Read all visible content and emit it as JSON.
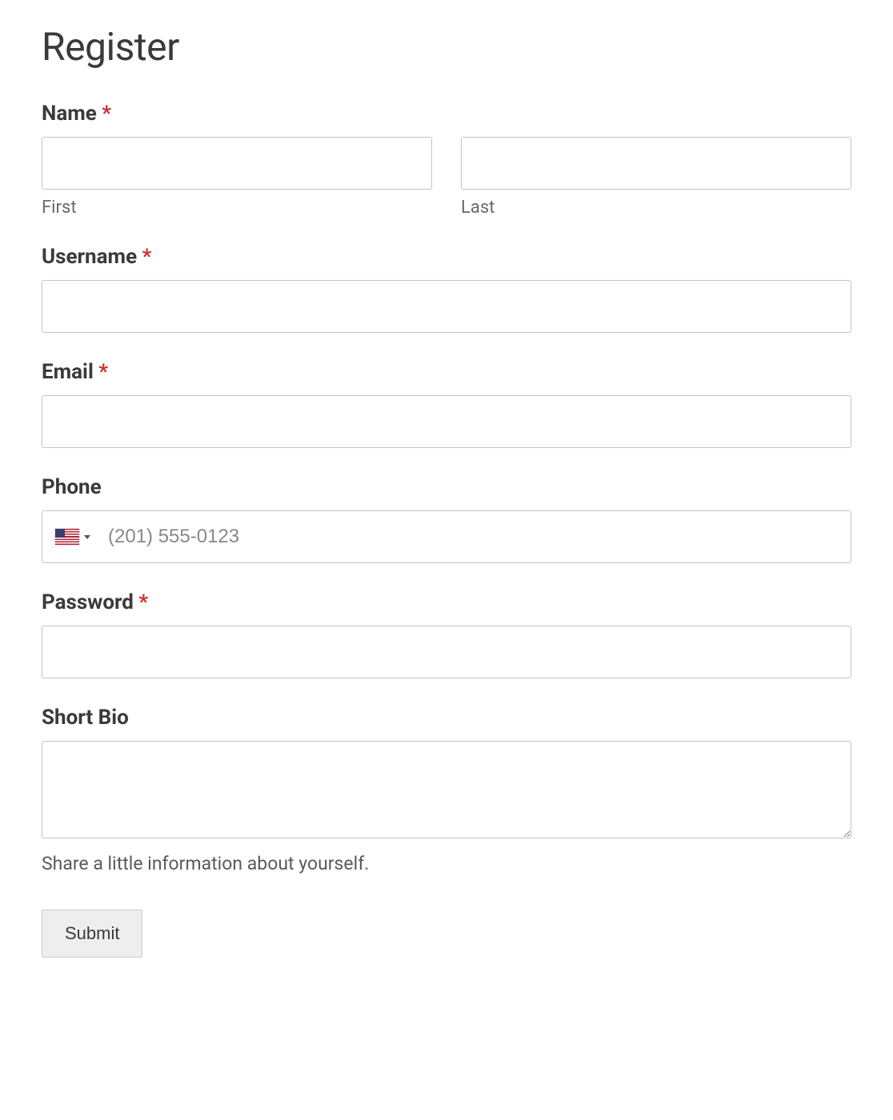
{
  "title": "Register",
  "fields": {
    "name": {
      "label": "Name",
      "required": "*",
      "first": {
        "sublabel": "First",
        "value": ""
      },
      "last": {
        "sublabel": "Last",
        "value": ""
      }
    },
    "username": {
      "label": "Username",
      "required": "*",
      "value": ""
    },
    "email": {
      "label": "Email",
      "required": "*",
      "value": ""
    },
    "phone": {
      "label": "Phone",
      "placeholder": "(201) 555-0123",
      "value": ""
    },
    "password": {
      "label": "Password",
      "required": "*",
      "value": ""
    },
    "bio": {
      "label": "Short Bio",
      "value": "",
      "description": "Share a little information about yourself."
    }
  },
  "submit": {
    "label": "Submit"
  }
}
